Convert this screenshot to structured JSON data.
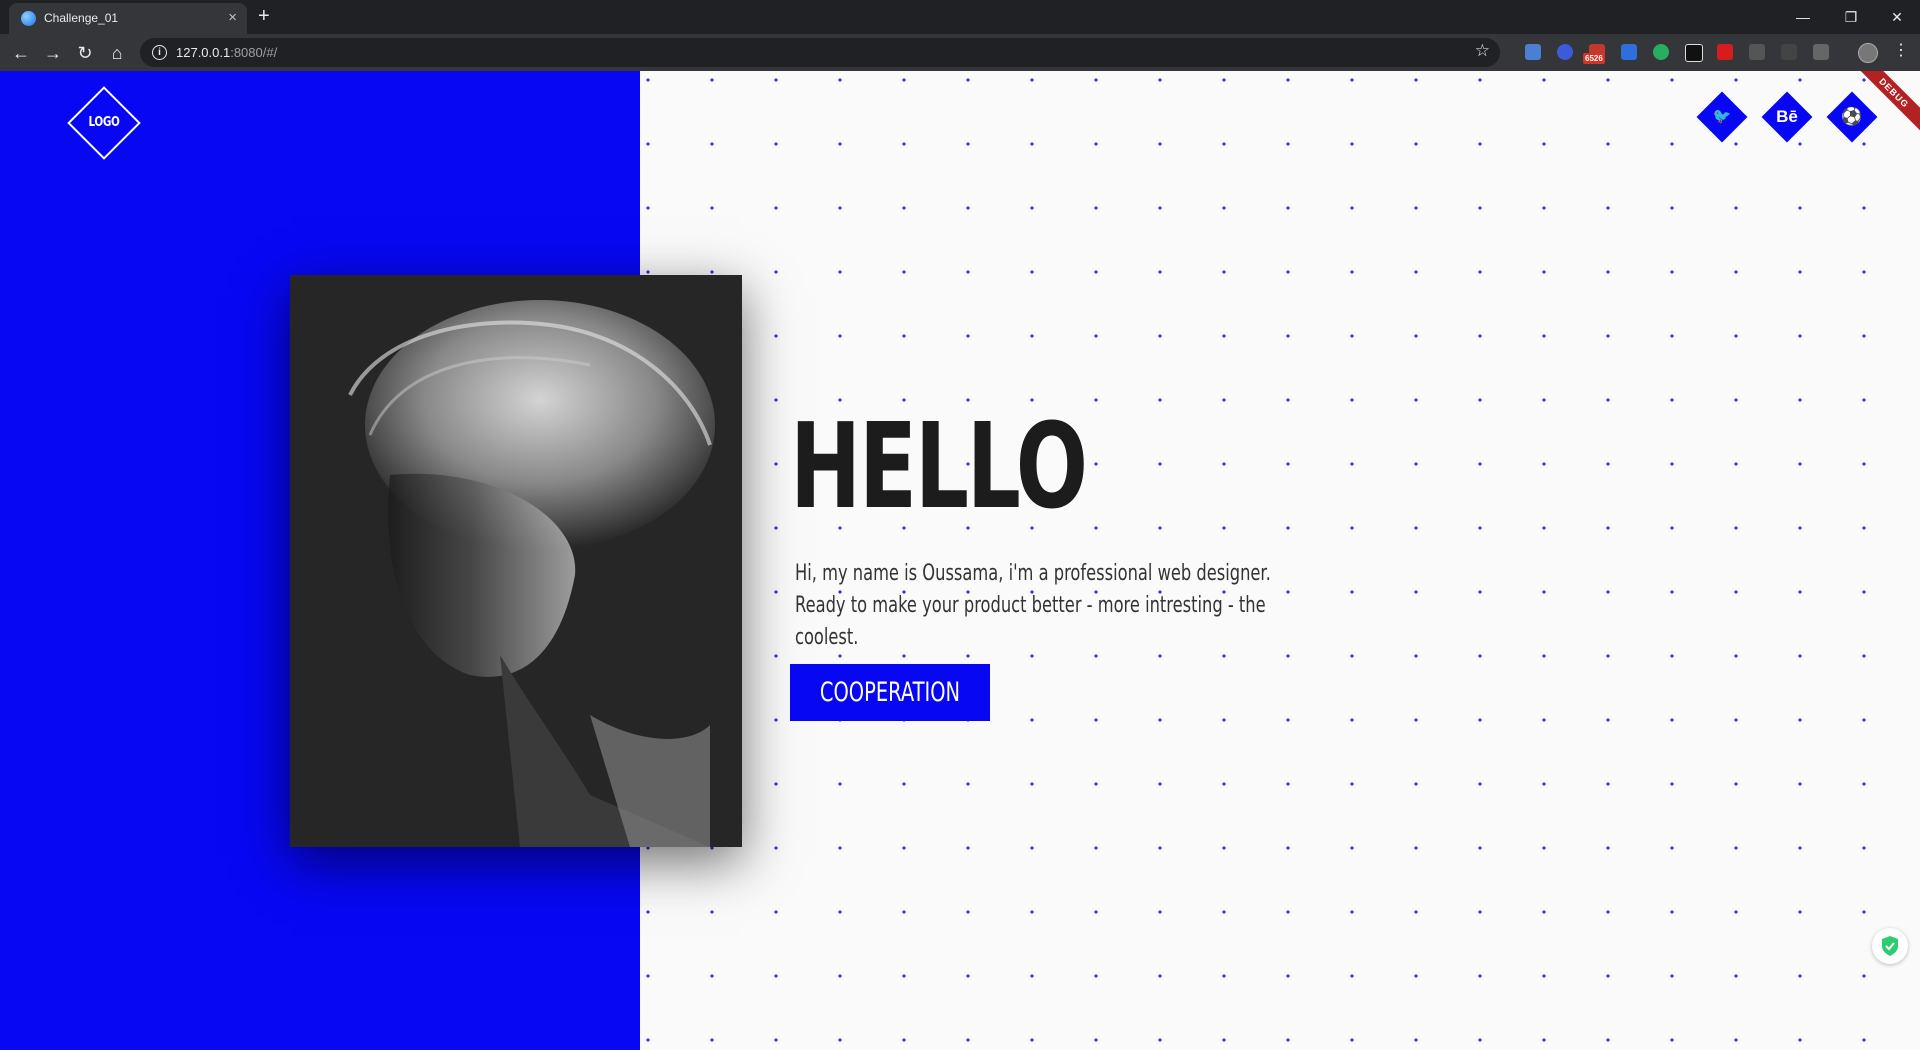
{
  "browser": {
    "tab_title": "Challenge_01",
    "url_host": "127.0.0.1",
    "url_rest": ":8080/#/",
    "extension_badge": "6526"
  },
  "page": {
    "logo_text": "LOGO",
    "debug_banner": "DEBUG",
    "social": [
      {
        "icon": "twitter-icon",
        "glyph": "🐦"
      },
      {
        "icon": "behance-icon",
        "glyph": "Bē"
      },
      {
        "icon": "dribbble-icon",
        "glyph": "⚽"
      }
    ],
    "headline": "HELLO",
    "intro_line_1": "Hi, my name is Oussama, i'm a professional web designer.",
    "intro_line_2": "Ready to make your product better - more intresting - the coolest.",
    "cta_label": "COOPERATION",
    "colors": {
      "accent": "#0707f4",
      "background": "#fafafa",
      "headline": "#1c1c1c"
    }
  }
}
